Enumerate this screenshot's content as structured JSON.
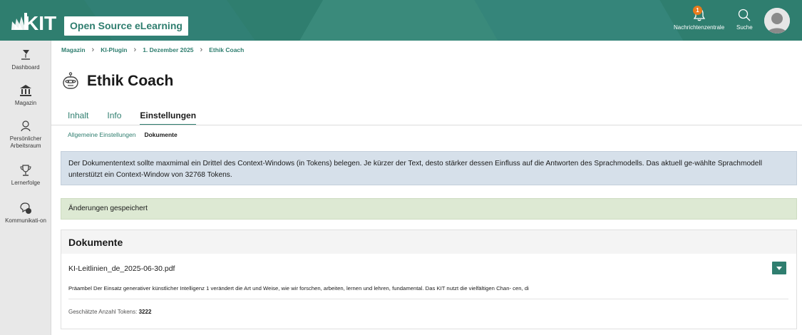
{
  "header": {
    "app_title": "Open Source eLearning",
    "notifications_label": "Nachrichtenzentrale",
    "notifications_count": "1",
    "search_label": "Suche"
  },
  "sidebar": {
    "items": [
      {
        "label": "Dashboard"
      },
      {
        "label": "Magazin"
      },
      {
        "label": "Persönlicher Arbeitsraum"
      },
      {
        "label": "Lernerfolge"
      },
      {
        "label": "Kommunikati-on"
      }
    ]
  },
  "breadcrumb": [
    "Magazin",
    "KI-Plugin",
    "1. Dezember 2025",
    "Ethik Coach"
  ],
  "page": {
    "title": "Ethik Coach"
  },
  "tabs": [
    "Inhalt",
    "Info",
    "Einstellungen"
  ],
  "subtabs": [
    "Allgemeine Einstellungen",
    "Dokumente"
  ],
  "info_message": "Der Dokumententext sollte maxmimal ein Drittel des Context-Windows (in Tokens) belegen. Je kürzer der Text, desto stärker dessen Einfluss auf die Antworten des Sprachmodells. Das aktuell ge-wählte Sprachmodell unterstützt ein Context-Window von 32768 Tokens.",
  "success_message": "Änderungen gespeichert",
  "documents": {
    "heading": "Dokumente",
    "items": [
      {
        "name": "KI-Leitlinien_de_2025-06-30.pdf",
        "excerpt": "Präambel Der Einsatz generativer künstlicher Intelligenz 1 verändert die Art und Weise, wie wir forschen, arbeiten, lernen und lehren, fundamental. Das KIT nutzt die vielfältigen Chan- cen, di",
        "tokens_label": "Geschätzte Anzahl Tokens:",
        "tokens_value": "3222"
      }
    ]
  },
  "colors": {
    "brand": "#2f7e6f",
    "info_bg": "#d6e0ea",
    "success_bg": "#dde9d3",
    "badge": "#e87a1c"
  }
}
